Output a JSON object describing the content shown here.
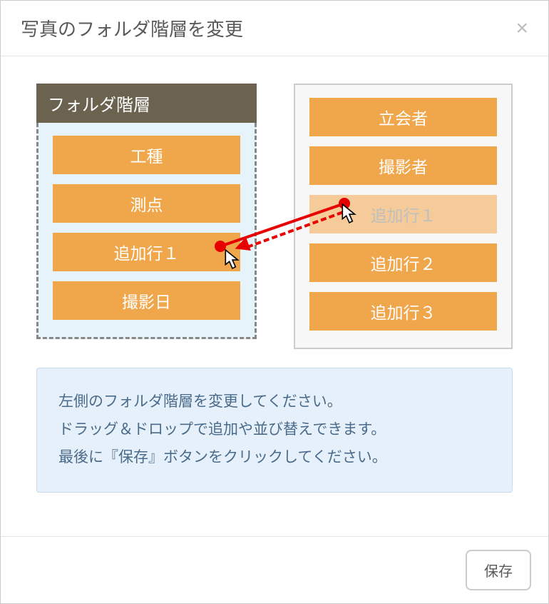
{
  "header": {
    "title": "写真のフォルダ階層を変更",
    "close_label": "×"
  },
  "left_panel": {
    "heading": "フォルダ階層",
    "items": [
      "工種",
      "測点",
      "追加行１",
      "撮影日"
    ]
  },
  "right_panel": {
    "items": [
      "立会者",
      "撮影者",
      "追加行１",
      "追加行２",
      "追加行３"
    ],
    "faded_index": 2
  },
  "info": {
    "line1": "左側のフォルダ階層を変更してください。",
    "line2": "ドラッグ＆ドロップで追加や並び替えできます。",
    "line3": "最後に『保存』ボタンをクリックしてください。"
  },
  "footer": {
    "save_label": "保存"
  }
}
